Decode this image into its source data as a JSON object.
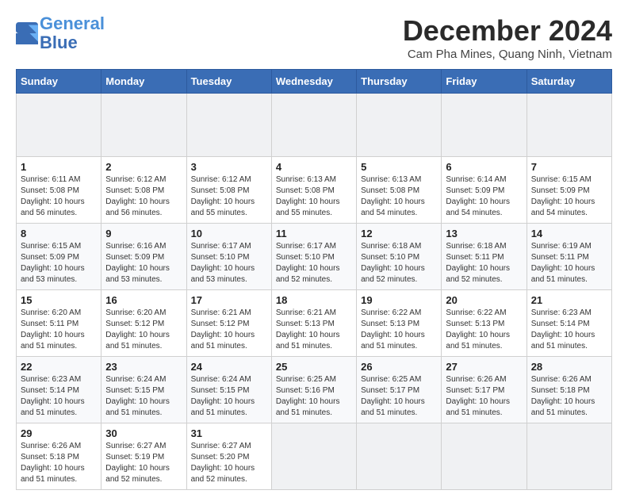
{
  "header": {
    "logo_line1": "General",
    "logo_line2": "Blue",
    "month_title": "December 2024",
    "location": "Cam Pha Mines, Quang Ninh, Vietnam"
  },
  "calendar": {
    "weekdays": [
      "Sunday",
      "Monday",
      "Tuesday",
      "Wednesday",
      "Thursday",
      "Friday",
      "Saturday"
    ],
    "weeks": [
      [
        {
          "day": "",
          "empty": true
        },
        {
          "day": "",
          "empty": true
        },
        {
          "day": "",
          "empty": true
        },
        {
          "day": "",
          "empty": true
        },
        {
          "day": "",
          "empty": true
        },
        {
          "day": "",
          "empty": true
        },
        {
          "day": "",
          "empty": true
        }
      ],
      [
        {
          "day": "1",
          "sunrise": "6:11 AM",
          "sunset": "5:08 PM",
          "daylight": "10 hours and 56 minutes."
        },
        {
          "day": "2",
          "sunrise": "6:12 AM",
          "sunset": "5:08 PM",
          "daylight": "10 hours and 56 minutes."
        },
        {
          "day": "3",
          "sunrise": "6:12 AM",
          "sunset": "5:08 PM",
          "daylight": "10 hours and 55 minutes."
        },
        {
          "day": "4",
          "sunrise": "6:13 AM",
          "sunset": "5:08 PM",
          "daylight": "10 hours and 55 minutes."
        },
        {
          "day": "5",
          "sunrise": "6:13 AM",
          "sunset": "5:08 PM",
          "daylight": "10 hours and 54 minutes."
        },
        {
          "day": "6",
          "sunrise": "6:14 AM",
          "sunset": "5:09 PM",
          "daylight": "10 hours and 54 minutes."
        },
        {
          "day": "7",
          "sunrise": "6:15 AM",
          "sunset": "5:09 PM",
          "daylight": "10 hours and 54 minutes."
        }
      ],
      [
        {
          "day": "8",
          "sunrise": "6:15 AM",
          "sunset": "5:09 PM",
          "daylight": "10 hours and 53 minutes."
        },
        {
          "day": "9",
          "sunrise": "6:16 AM",
          "sunset": "5:09 PM",
          "daylight": "10 hours and 53 minutes."
        },
        {
          "day": "10",
          "sunrise": "6:17 AM",
          "sunset": "5:10 PM",
          "daylight": "10 hours and 53 minutes."
        },
        {
          "day": "11",
          "sunrise": "6:17 AM",
          "sunset": "5:10 PM",
          "daylight": "10 hours and 52 minutes."
        },
        {
          "day": "12",
          "sunrise": "6:18 AM",
          "sunset": "5:10 PM",
          "daylight": "10 hours and 52 minutes."
        },
        {
          "day": "13",
          "sunrise": "6:18 AM",
          "sunset": "5:11 PM",
          "daylight": "10 hours and 52 minutes."
        },
        {
          "day": "14",
          "sunrise": "6:19 AM",
          "sunset": "5:11 PM",
          "daylight": "10 hours and 51 minutes."
        }
      ],
      [
        {
          "day": "15",
          "sunrise": "6:20 AM",
          "sunset": "5:11 PM",
          "daylight": "10 hours and 51 minutes."
        },
        {
          "day": "16",
          "sunrise": "6:20 AM",
          "sunset": "5:12 PM",
          "daylight": "10 hours and 51 minutes."
        },
        {
          "day": "17",
          "sunrise": "6:21 AM",
          "sunset": "5:12 PM",
          "daylight": "10 hours and 51 minutes."
        },
        {
          "day": "18",
          "sunrise": "6:21 AM",
          "sunset": "5:13 PM",
          "daylight": "10 hours and 51 minutes."
        },
        {
          "day": "19",
          "sunrise": "6:22 AM",
          "sunset": "5:13 PM",
          "daylight": "10 hours and 51 minutes."
        },
        {
          "day": "20",
          "sunrise": "6:22 AM",
          "sunset": "5:13 PM",
          "daylight": "10 hours and 51 minutes."
        },
        {
          "day": "21",
          "sunrise": "6:23 AM",
          "sunset": "5:14 PM",
          "daylight": "10 hours and 51 minutes."
        }
      ],
      [
        {
          "day": "22",
          "sunrise": "6:23 AM",
          "sunset": "5:14 PM",
          "daylight": "10 hours and 51 minutes."
        },
        {
          "day": "23",
          "sunrise": "6:24 AM",
          "sunset": "5:15 PM",
          "daylight": "10 hours and 51 minutes."
        },
        {
          "day": "24",
          "sunrise": "6:24 AM",
          "sunset": "5:15 PM",
          "daylight": "10 hours and 51 minutes."
        },
        {
          "day": "25",
          "sunrise": "6:25 AM",
          "sunset": "5:16 PM",
          "daylight": "10 hours and 51 minutes."
        },
        {
          "day": "26",
          "sunrise": "6:25 AM",
          "sunset": "5:17 PM",
          "daylight": "10 hours and 51 minutes."
        },
        {
          "day": "27",
          "sunrise": "6:26 AM",
          "sunset": "5:17 PM",
          "daylight": "10 hours and 51 minutes."
        },
        {
          "day": "28",
          "sunrise": "6:26 AM",
          "sunset": "5:18 PM",
          "daylight": "10 hours and 51 minutes."
        }
      ],
      [
        {
          "day": "29",
          "sunrise": "6:26 AM",
          "sunset": "5:18 PM",
          "daylight": "10 hours and 51 minutes."
        },
        {
          "day": "30",
          "sunrise": "6:27 AM",
          "sunset": "5:19 PM",
          "daylight": "10 hours and 52 minutes."
        },
        {
          "day": "31",
          "sunrise": "6:27 AM",
          "sunset": "5:20 PM",
          "daylight": "10 hours and 52 minutes."
        },
        {
          "day": "",
          "empty": true
        },
        {
          "day": "",
          "empty": true
        },
        {
          "day": "",
          "empty": true
        },
        {
          "day": "",
          "empty": true
        }
      ]
    ]
  }
}
